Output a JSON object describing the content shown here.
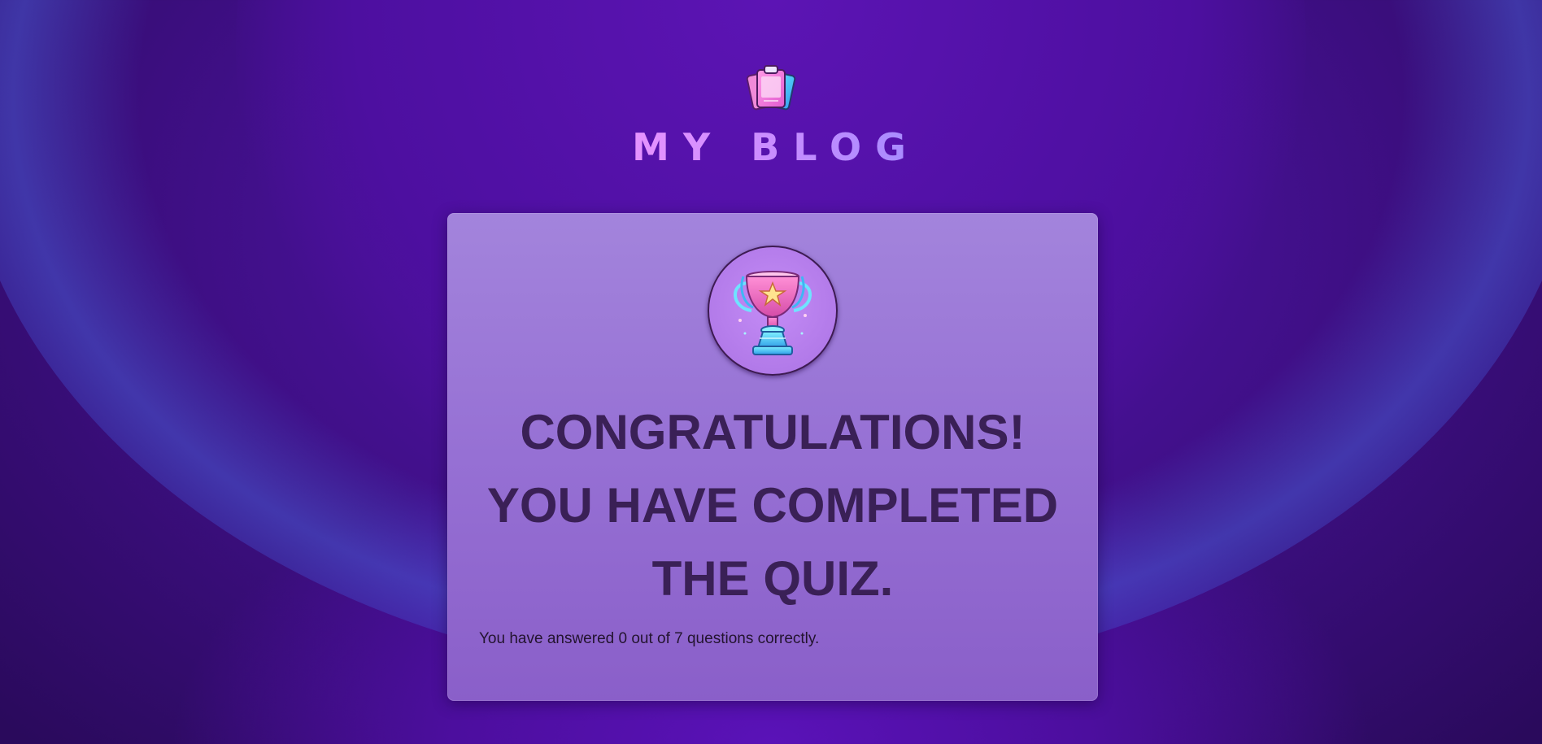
{
  "site": {
    "logo_icon": "clipboard-cards-icon",
    "title": "MY BLOG"
  },
  "result_card": {
    "badge_icon": "trophy-icon",
    "headline": "CONGRATULATIONS! YOU HAVE COMPLETED THE QUIZ.",
    "score_text": "You have answered 0 out of 7 questions correctly."
  },
  "colors": {
    "background": "#4a0f9c",
    "card": "#9670d4",
    "headline": "#3a2056",
    "title_gradient_start": "#e692ff",
    "title_gradient_end": "#a58cff"
  }
}
